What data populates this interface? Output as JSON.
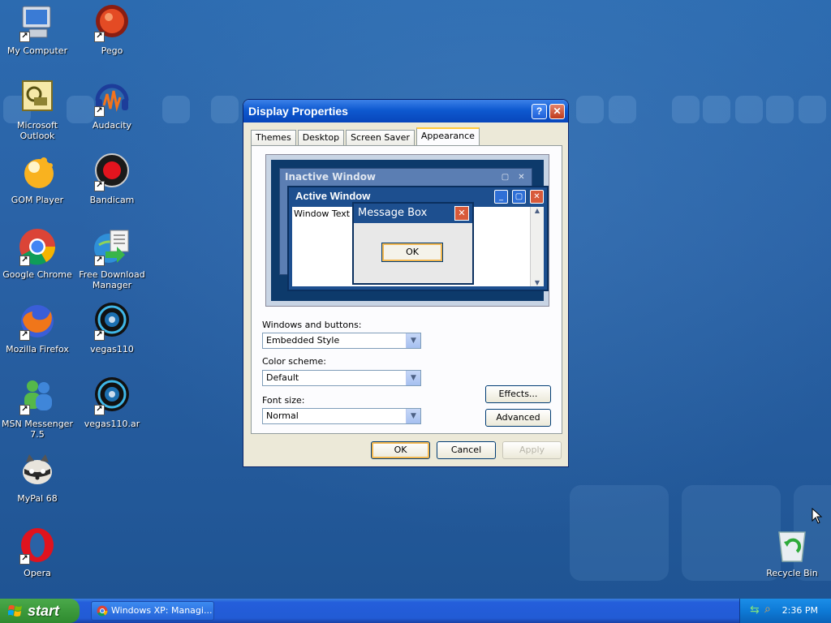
{
  "desktop": {
    "icons": [
      {
        "label": "My Computer"
      },
      {
        "label": "Pego"
      },
      {
        "label": "Microsoft Outlook"
      },
      {
        "label": "Audacity"
      },
      {
        "label": "GOM Player"
      },
      {
        "label": "Bandicam"
      },
      {
        "label": "Google Chrome"
      },
      {
        "label": "Free Download Manager"
      },
      {
        "label": "Mozilla Firefox"
      },
      {
        "label": "vegas110"
      },
      {
        "label": "MSN Messenger 7.5"
      },
      {
        "label": "vegas110.ar"
      },
      {
        "label": "MyPal 68"
      },
      {
        "label": "Opera"
      },
      {
        "label": "Recycle Bin"
      }
    ]
  },
  "dialog": {
    "title": "Display Properties",
    "help_label": "?",
    "close_label": "✕",
    "tabs": [
      {
        "label": "Themes"
      },
      {
        "label": "Desktop"
      },
      {
        "label": "Screen Saver"
      },
      {
        "label": "Appearance"
      }
    ],
    "preview": {
      "inactive_title": "Inactive Window",
      "active_title": "Active Window",
      "window_text": "Window Text",
      "message_title": "Message Box",
      "message_ok": "OK"
    },
    "windows_buttons_label": "Windows and buttons:",
    "windows_buttons_value": "Embedded Style",
    "color_scheme_label": "Color scheme:",
    "color_scheme_value": "Default",
    "font_size_label": "Font size:",
    "font_size_value": "Normal",
    "effects_label": "Effects...",
    "advanced_label": "Advanced",
    "ok_label": "OK",
    "cancel_label": "Cancel",
    "apply_label": "Apply"
  },
  "taskbar": {
    "start_label": "start",
    "task_label": "Windows XP: Managi...",
    "clock": "2:36 PM"
  }
}
